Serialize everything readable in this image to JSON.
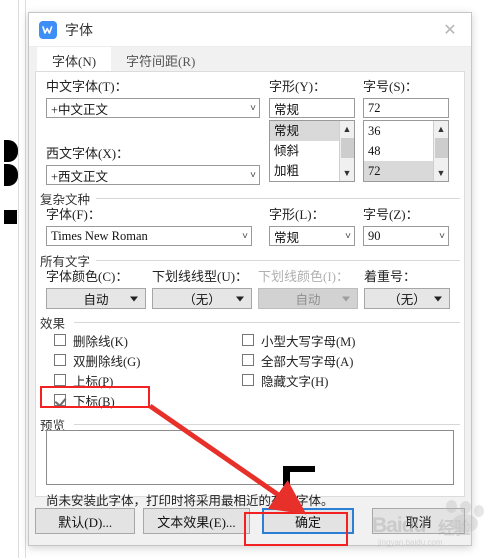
{
  "window": {
    "title": "字体",
    "app_icon": "wps-logo-icon",
    "close_label": "✕"
  },
  "tabs": [
    {
      "label": "字体(N)",
      "active": true
    },
    {
      "label": "字符间距(R)",
      "active": false
    }
  ],
  "latin_section": {
    "chinese_font_label": "中文字体(T)：",
    "chinese_font_value": "+中文正文",
    "western_font_label": "西文字体(X)：",
    "western_font_value": "+西文正文",
    "style_label": "字形(Y)：",
    "style_value": "常规",
    "style_options": [
      "常规",
      "倾斜",
      "加粗"
    ],
    "style_selected": "常规",
    "size_label": "字号(S)：",
    "size_value": "72",
    "size_options": [
      "36",
      "48",
      "72"
    ],
    "size_selected": "72"
  },
  "complex_section": {
    "title": "复杂文种",
    "font_label": "字体(F)：",
    "font_value": "Times New Roman",
    "style_label": "字形(L)：",
    "style_value": "常规",
    "size_label": "字号(Z)：",
    "size_value": "90"
  },
  "all_text_section": {
    "title": "所有文字",
    "font_color_label": "字体颜色(C)：",
    "font_color_value": "自动",
    "underline_style_label": "下划线线型(U)：",
    "underline_style_value": "（无）",
    "underline_color_label": "下划线颜色(I)：",
    "underline_color_value": "自动",
    "underline_color_disabled": true,
    "emphasis_label": "着重号：",
    "emphasis_value": "（无）"
  },
  "effects_section": {
    "title": "效果",
    "left_column": [
      {
        "label": "删除线(K)",
        "checked": false
      },
      {
        "label": "双删除线(G)",
        "checked": false
      },
      {
        "label": "上标(P)",
        "checked": false
      },
      {
        "label": "下标(B)",
        "checked": true,
        "highlighted": true
      }
    ],
    "right_column": [
      {
        "label": "小型大写字母(M)",
        "checked": false
      },
      {
        "label": "全部大写字母(A)",
        "checked": false
      },
      {
        "label": "隐藏文字(H)",
        "checked": false
      }
    ]
  },
  "preview_section": {
    "title": "预览",
    "note": "尚未安装此字体，打印时将采用最相近的有效字体。"
  },
  "footer": {
    "default_label": "默认(D)...",
    "text_effects_label": "文本效果(E)...",
    "ok_label": "确定",
    "cancel_label": "取消"
  },
  "annotations": {
    "highlight_color": "#f32121",
    "focus_color": "#2b7fd4",
    "arrow_color": "#e8302a"
  },
  "watermark": {
    "brand": "Baidu",
    "suffix": "经验",
    "url": "jingyan.baidu.com"
  }
}
